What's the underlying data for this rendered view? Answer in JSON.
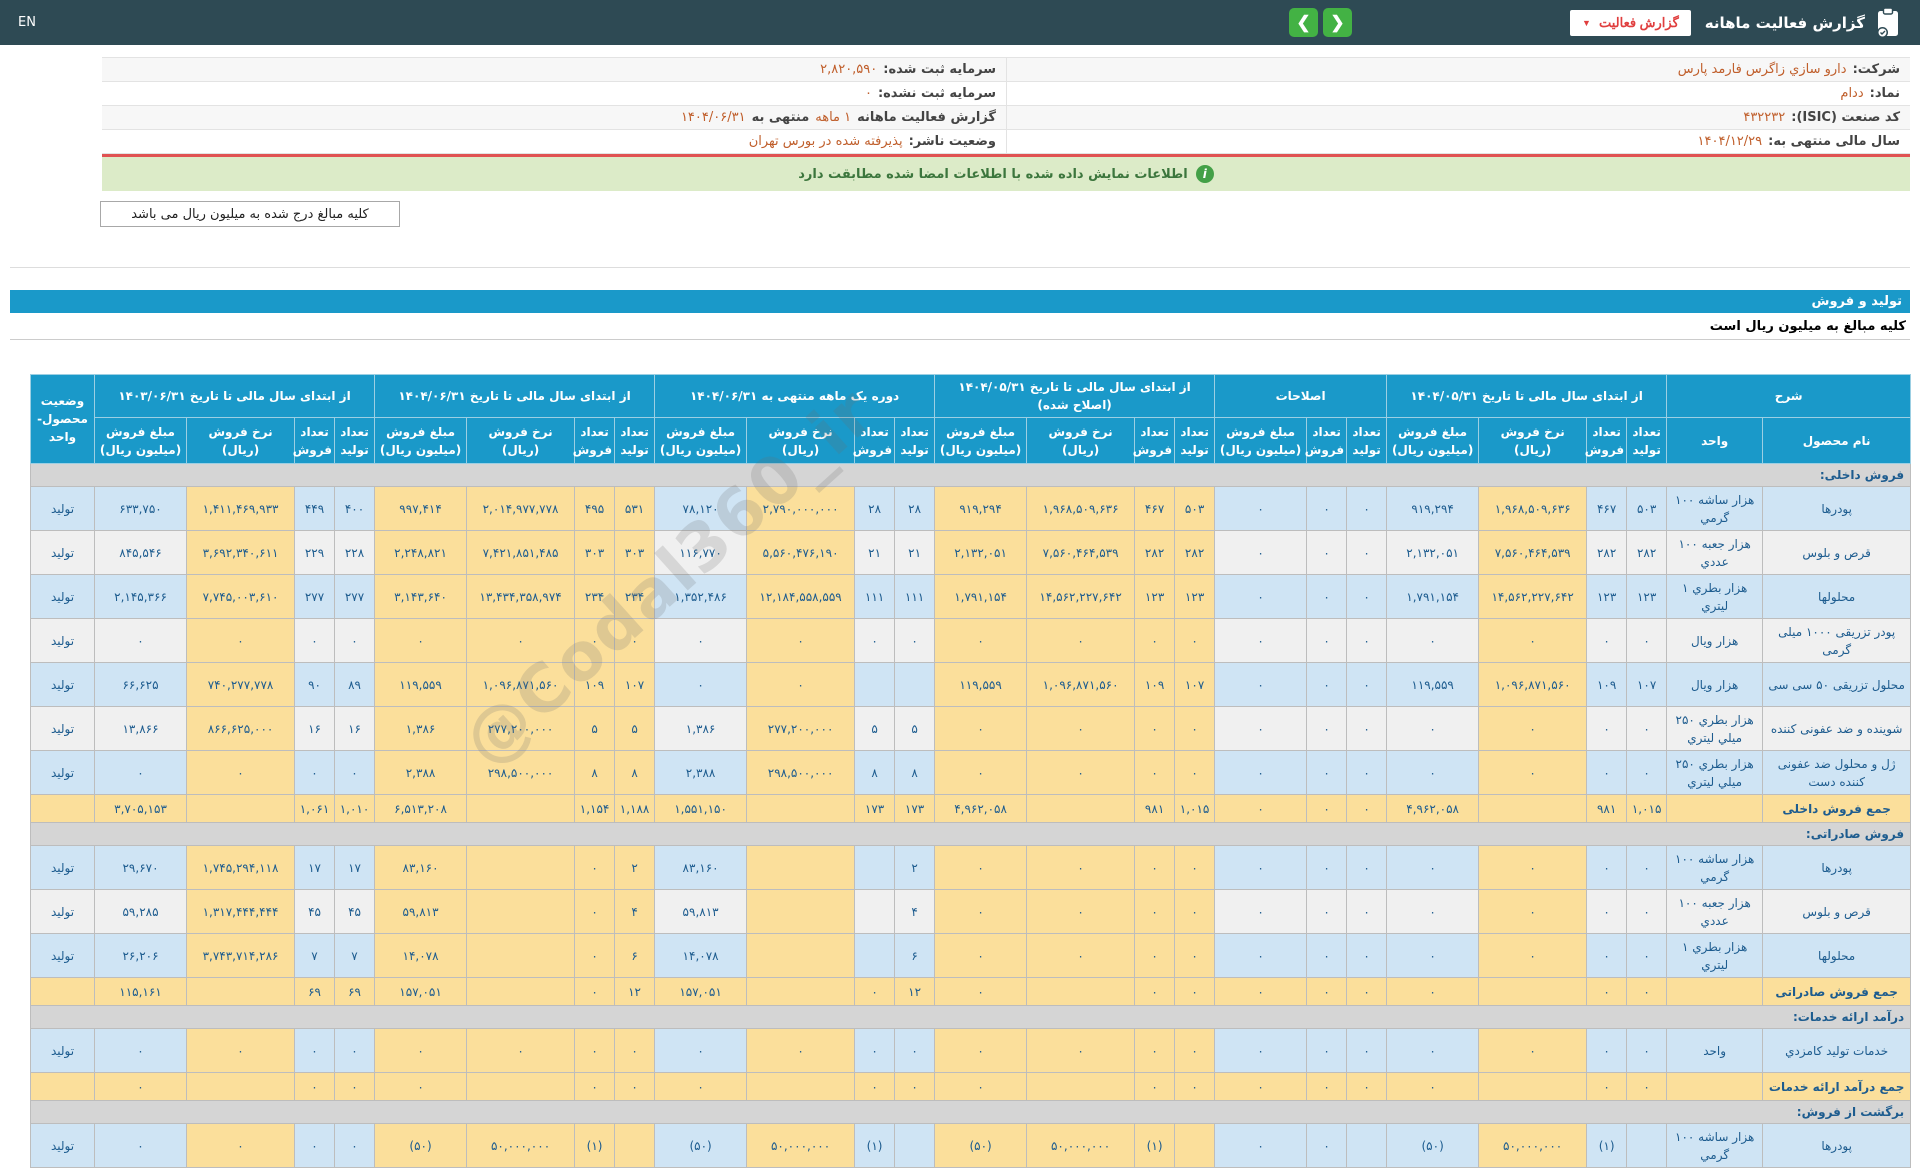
{
  "colors": {
    "accent_blue": "#1a99c9",
    "topbar": "#2e4a54",
    "green_button": "#43b244",
    "red_accent": "#e03e3e",
    "cell_yellow": "#fbdf9b",
    "cell_blue": "#cfe4f4",
    "notice_green": "#dcebc8",
    "value_orange": "#c05f2c",
    "text_navy": "#1d5c8f"
  },
  "topbar": {
    "lang": "EN",
    "title": "گزارش فعالیت ماهانه",
    "dropdown_label": "گزارش فعالیت",
    "nav_prev": "❮",
    "nav_next": "❯"
  },
  "info": {
    "rows": [
      {
        "r_label": "شرکت:",
        "r_value": "دارو سازي زاگرس فارمد پارس",
        "l_label": "سرمایه ثبت شده:",
        "l_value": "۲,۸۲۰,۵۹۰"
      },
      {
        "r_label": "نماد:",
        "r_value": "ددام",
        "l_label": "سرمایه ثبت نشده:",
        "l_value": "۰"
      },
      {
        "r_label": "کد صنعت (ISIC):",
        "r_value": "۴۳۲۲۳۲",
        "l_parts": [
          {
            "t": "گزارش فعالیت ماهانه ",
            "hl": false
          },
          {
            "t": "۱ ماهه",
            "hl": true
          },
          {
            "t": "منتهی به",
            "hl": false
          },
          {
            "t": "۱۴۰۴/۰۶/۳۱",
            "hl": true
          }
        ]
      },
      {
        "r_label": "سال مالی منتهی به:",
        "r_value": "۱۴۰۴/۱۲/۲۹",
        "l_label": "وضعیت ناشر:",
        "l_value": "پذیرفته شده در بورس تهران"
      }
    ]
  },
  "notice_text": "اطلاعات نمایش داده شده با اطلاعات امضا شده مطابقت دارد",
  "unit_note_button": "کلیه مبالغ درج شده به میلیون ریال می باشد",
  "section_band": "تولید و فروش",
  "amounts_note": "کلیه مبالغ به میلیون ریال است",
  "watermark": "@Codal360_ir",
  "table": {
    "col_headers": {
      "t": "تعداد تولید",
      "f": "تعداد فروش",
      "n": "نرخ فروش (ریال)",
      "m": "مبلغ فروش (میلیون ریال)"
    },
    "groups": [
      {
        "label": "شرح",
        "subs": [
          "نام محصول",
          "واحد"
        ],
        "widths": [
          148,
          96
        ]
      },
      {
        "label": "از ابتدای سال مالی تا تاریخ ۱۴۰۴/۰۵/۳۱",
        "subs": [
          "t",
          "f",
          "n",
          "m"
        ]
      },
      {
        "label": "اصلاحات",
        "subs": [
          "t",
          "f",
          "m"
        ]
      },
      {
        "label": "از ابتدای سال مالی تا تاریخ ۱۴۰۴/۰۵/۳۱ (اصلاح شده)",
        "subs": [
          "t",
          "f",
          "n",
          "m"
        ]
      },
      {
        "label": "دوره یک ماهه منتهی به ۱۴۰۴/۰۶/۳۱",
        "subs": [
          "t",
          "f",
          "n",
          "m"
        ]
      },
      {
        "label": "از ابتدای سال مالی تا تاریخ ۱۴۰۴/۰۶/۳۱",
        "subs": [
          "t",
          "f",
          "n",
          "m"
        ]
      },
      {
        "label": "از ابتدای سال مالی تا تاریخ ۱۴۰۳/۰۶/۳۱",
        "subs": [
          "t",
          "f",
          "n",
          "m"
        ]
      },
      {
        "label": "وضعیت محصول-واحد",
        "subs": []
      }
    ],
    "sub_widths": {
      "t": 40,
      "f": 40,
      "n": 108,
      "m": 92
    },
    "status_width": 64,
    "yellow_columns": [
      2,
      7,
      8,
      9,
      10,
      13,
      15,
      16,
      17,
      18,
      21
    ],
    "rows": [
      {
        "kind": "section",
        "label": "فروش داخلی:"
      },
      {
        "kind": "data",
        "shade": "b",
        "name": "پودرها",
        "unit": "هزار ساشه ۱۰۰ گرمي",
        "status": "تولید",
        "v": [
          "۵۰۳",
          "۴۶۷",
          "۱,۹۶۸,۵۰۹,۶۳۶",
          "۹۱۹,۲۹۴",
          "۰",
          "۰",
          "۰",
          "۵۰۳",
          "۴۶۷",
          "۱,۹۶۸,۵۰۹,۶۳۶",
          "۹۱۹,۲۹۴",
          "۲۸",
          "۲۸",
          "۲,۷۹۰,۰۰۰,۰۰۰",
          "۷۸,۱۲۰",
          "۵۳۱",
          "۴۹۵",
          "۲,۰۱۴,۹۷۷,۷۷۸",
          "۹۹۷,۴۱۴",
          "۴۰۰",
          "۴۴۹",
          "۱,۴۱۱,۴۶۹,۹۳۳",
          "۶۳۳,۷۵۰"
        ]
      },
      {
        "kind": "data",
        "shade": "w",
        "name": "قرص و بلوس",
        "unit": "هزار جعبه ۱۰۰ عددي",
        "status": "تولید",
        "v": [
          "۲۸۲",
          "۲۸۲",
          "۷,۵۶۰,۴۶۴,۵۳۹",
          "۲,۱۳۲,۰۵۱",
          "۰",
          "۰",
          "۰",
          "۲۸۲",
          "۲۸۲",
          "۷,۵۶۰,۴۶۴,۵۳۹",
          "۲,۱۳۲,۰۵۱",
          "۲۱",
          "۲۱",
          "۵,۵۶۰,۴۷۶,۱۹۰",
          "۱۱۶,۷۷۰",
          "۳۰۳",
          "۳۰۳",
          "۷,۴۲۱,۸۵۱,۴۸۵",
          "۲,۲۴۸,۸۲۱",
          "۲۲۸",
          "۲۲۹",
          "۳,۶۹۲,۳۴۰,۶۱۱",
          "۸۴۵,۵۴۶"
        ]
      },
      {
        "kind": "data",
        "shade": "b",
        "name": "محلولها",
        "unit": "هزار بطري ۱ ليتري",
        "status": "تولید",
        "v": [
          "۱۲۳",
          "۱۲۳",
          "۱۴,۵۶۲,۲۲۷,۶۴۲",
          "۱,۷۹۱,۱۵۴",
          "۰",
          "۰",
          "۰",
          "۱۲۳",
          "۱۲۳",
          "۱۴,۵۶۲,۲۲۷,۶۴۲",
          "۱,۷۹۱,۱۵۴",
          "۱۱۱",
          "۱۱۱",
          "۱۲,۱۸۴,۵۵۸,۵۵۹",
          "۱,۳۵۲,۴۸۶",
          "۲۳۴",
          "۲۳۴",
          "۱۳,۴۳۴,۳۵۸,۹۷۴",
          "۳,۱۴۳,۶۴۰",
          "۲۷۷",
          "۲۷۷",
          "۷,۷۴۵,۰۰۳,۶۱۰",
          "۲,۱۴۵,۳۶۶"
        ]
      },
      {
        "kind": "data",
        "shade": "w",
        "name": "پودر تزریقی ۱۰۰۰ میلی گرمی",
        "unit": "هزار ویال",
        "status": "تولید",
        "v": [
          "۰",
          "۰",
          "۰",
          "۰",
          "۰",
          "۰",
          "۰",
          "۰",
          "۰",
          "۰",
          "۰",
          "۰",
          "۰",
          "۰",
          "۰",
          "۰",
          "۰",
          "۰",
          "۰",
          "۰",
          "۰",
          "۰",
          "۰"
        ]
      },
      {
        "kind": "data",
        "shade": "b",
        "name": "محلول تزریقی ۵۰ سی سی",
        "unit": "هزار ویال",
        "status": "تولید",
        "v": [
          "۱۰۷",
          "۱۰۹",
          "۱,۰۹۶,۸۷۱,۵۶۰",
          "۱۱۹,۵۵۹",
          "۰",
          "۰",
          "۰",
          "۱۰۷",
          "۱۰۹",
          "۱,۰۹۶,۸۷۱,۵۶۰",
          "۱۱۹,۵۵۹",
          "",
          "",
          "۰",
          "۰",
          "۱۰۷",
          "۱۰۹",
          "۱,۰۹۶,۸۷۱,۵۶۰",
          "۱۱۹,۵۵۹",
          "۸۹",
          "۹۰",
          "۷۴۰,۲۷۷,۷۷۸",
          "۶۶,۶۲۵"
        ]
      },
      {
        "kind": "data",
        "shade": "w",
        "name": "شوینده و ضد عفونی کننده",
        "unit": "هزار بطري ۲۵۰ ميلي ليتري",
        "status": "تولید",
        "v": [
          "۰",
          "۰",
          "۰",
          "۰",
          "۰",
          "۰",
          "۰",
          "۰",
          "۰",
          "۰",
          "۰",
          "۵",
          "۵",
          "۲۷۷,۲۰۰,۰۰۰",
          "۱,۳۸۶",
          "۵",
          "۵",
          "۲۷۷,۲۰۰,۰۰۰",
          "۱,۳۸۶",
          "۱۶",
          "۱۶",
          "۸۶۶,۶۲۵,۰۰۰",
          "۱۳,۸۶۶"
        ]
      },
      {
        "kind": "data",
        "shade": "b",
        "name": "ژل و محلول ضد عفونی کننده دست",
        "unit": "هزار بطري ۲۵۰ ميلي ليتري",
        "status": "تولید",
        "v": [
          "۰",
          "۰",
          "۰",
          "۰",
          "۰",
          "۰",
          "۰",
          "۰",
          "۰",
          "۰",
          "۰",
          "۸",
          "۸",
          "۲۹۸,۵۰۰,۰۰۰",
          "۲,۳۸۸",
          "۸",
          "۸",
          "۲۹۸,۵۰۰,۰۰۰",
          "۲,۳۸۸",
          "۰",
          "۰",
          "۰",
          "۰"
        ]
      },
      {
        "kind": "total",
        "name": "جمع فروش داخلی",
        "unit": "",
        "status": "",
        "v": [
          "۱,۰۱۵",
          "۹۸۱",
          "",
          "۴,۹۶۲,۰۵۸",
          "۰",
          "۰",
          "۰",
          "۱,۰۱۵",
          "۹۸۱",
          "",
          "۴,۹۶۲,۰۵۸",
          "۱۷۳",
          "۱۷۳",
          "",
          "۱,۵۵۱,۱۵۰",
          "۱,۱۸۸",
          "۱,۱۵۴",
          "",
          "۶,۵۱۳,۲۰۸",
          "۱,۰۱۰",
          "۱,۰۶۱",
          "",
          "۳,۷۰۵,۱۵۳"
        ]
      },
      {
        "kind": "section",
        "label": "فروش صادراتی:"
      },
      {
        "kind": "data",
        "shade": "b",
        "name": "پودرها",
        "unit": "هزار ساشه ۱۰۰ گرمي",
        "status": "تولید",
        "v": [
          "۰",
          "۰",
          "۰",
          "۰",
          "۰",
          "۰",
          "۰",
          "۰",
          "۰",
          "۰",
          "۰",
          "۲",
          "",
          "",
          "۸۳,۱۶۰",
          "۲",
          "۰",
          "",
          "۸۳,۱۶۰",
          "۱۷",
          "۱۷",
          "۱,۷۴۵,۲۹۴,۱۱۸",
          "۲۹,۶۷۰"
        ]
      },
      {
        "kind": "data",
        "shade": "w",
        "name": "قرص و بلوس",
        "unit": "هزار جعبه ۱۰۰ عددي",
        "status": "تولید",
        "v": [
          "۰",
          "۰",
          "۰",
          "۰",
          "۰",
          "۰",
          "۰",
          "۰",
          "۰",
          "۰",
          "۰",
          "۴",
          "",
          "",
          "۵۹,۸۱۳",
          "۴",
          "۰",
          "",
          "۵۹,۸۱۳",
          "۴۵",
          "۴۵",
          "۱,۳۱۷,۴۴۴,۴۴۴",
          "۵۹,۲۸۵"
        ]
      },
      {
        "kind": "data",
        "shade": "b",
        "name": "محلولها",
        "unit": "هزار بطري ۱ ليتري",
        "status": "تولید",
        "v": [
          "۰",
          "۰",
          "۰",
          "۰",
          "۰",
          "۰",
          "۰",
          "۰",
          "۰",
          "۰",
          "۰",
          "۶",
          "",
          "",
          "۱۴,۰۷۸",
          "۶",
          "۰",
          "",
          "۱۴,۰۷۸",
          "۷",
          "۷",
          "۳,۷۴۳,۷۱۴,۲۸۶",
          "۲۶,۲۰۶"
        ]
      },
      {
        "kind": "total",
        "name": "جمع فروش صادراتی",
        "unit": "",
        "status": "",
        "v": [
          "۰",
          "۰",
          "",
          "۰",
          "۰",
          "۰",
          "۰",
          "۰",
          "۰",
          "",
          "۰",
          "۱۲",
          "۰",
          "",
          "۱۵۷,۰۵۱",
          "۱۲",
          "۰",
          "",
          "۱۵۷,۰۵۱",
          "۶۹",
          "۶۹",
          "",
          "۱۱۵,۱۶۱"
        ]
      },
      {
        "kind": "section",
        "label": "درآمد ارائه خدمات:"
      },
      {
        "kind": "data",
        "shade": "b",
        "name": "خدمات تولید کامزدي",
        "unit": "واحد",
        "status": "تولید",
        "v": [
          "۰",
          "۰",
          "۰",
          "۰",
          "۰",
          "۰",
          "۰",
          "۰",
          "۰",
          "۰",
          "۰",
          "۰",
          "۰",
          "۰",
          "۰",
          "۰",
          "۰",
          "۰",
          "۰",
          "۰",
          "۰",
          "۰",
          "۰"
        ]
      },
      {
        "kind": "total",
        "name": "جمع درآمد ارائه خدمات",
        "unit": "",
        "status": "",
        "v": [
          "۰",
          "۰",
          "",
          "۰",
          "۰",
          "۰",
          "۰",
          "۰",
          "۰",
          "",
          "۰",
          "۰",
          "۰",
          "",
          "۰",
          "۰",
          "۰",
          "",
          "۰",
          "۰",
          "۰",
          "",
          "۰"
        ]
      },
      {
        "kind": "section",
        "label": "برگشت از فروش:"
      },
      {
        "kind": "data",
        "shade": "b",
        "name": "پودرها",
        "unit": "هزار ساشه ۱۰۰ گرمي",
        "status": "تولید",
        "v": [
          "",
          "(۱)",
          "۵۰,۰۰۰,۰۰۰",
          "(۵۰)",
          "",
          "۰",
          "۰",
          "",
          "(۱)",
          "۵۰,۰۰۰,۰۰۰",
          "(۵۰)",
          "",
          "(۱)",
          "۵۰,۰۰۰,۰۰۰",
          "(۵۰)",
          "",
          "(۱)",
          "۵۰,۰۰۰,۰۰۰",
          "(۵۰)",
          "۰",
          "۰",
          "۰",
          "۰"
        ]
      }
    ]
  }
}
